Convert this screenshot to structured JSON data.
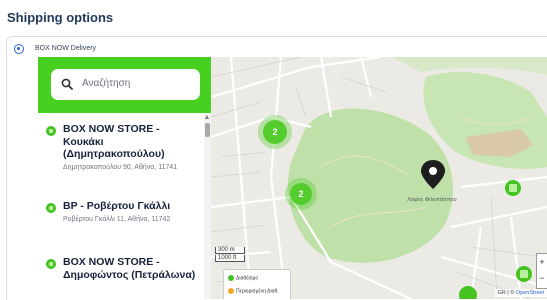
{
  "section_title": "Shipping options",
  "option": {
    "label": "BOX NOW Delivery",
    "selected": true
  },
  "search": {
    "placeholder": "Αναζήτηση",
    "icon": "search-icon"
  },
  "lockers": [
    {
      "name": "BOX NOW STORE - Κουκάκι (Δημητρακοπούλου)",
      "address": "Δημητρακοπούλου 90, Αθήνα, 11741"
    },
    {
      "name": "BP - Ροβέρτου Γκάλλι",
      "address": "Ροβέρτου Γκάλλι 11, Αθήνα, 11742"
    },
    {
      "name": "BOX NOW STORE - Δημοφώντος (Πετράλωνα)",
      "address": ""
    }
  ],
  "map": {
    "clusters": [
      "2",
      "2"
    ],
    "pin_label": "Λόφος Φιλοπάππου",
    "scale": [
      "300 m",
      "1000 ft"
    ],
    "legend": [
      "Διαθέσιμο",
      "Περιορισμένη Διαθ."
    ],
    "attribution_prefix": "GR | © ",
    "attribution_link": "OpenStreet",
    "zoom_plus": "+",
    "zoom_minus": "−",
    "colors": {
      "brand_green": "#48d020",
      "park_green": "#bfe1a9",
      "available": "#44c321",
      "limited": "#f5a623"
    }
  }
}
